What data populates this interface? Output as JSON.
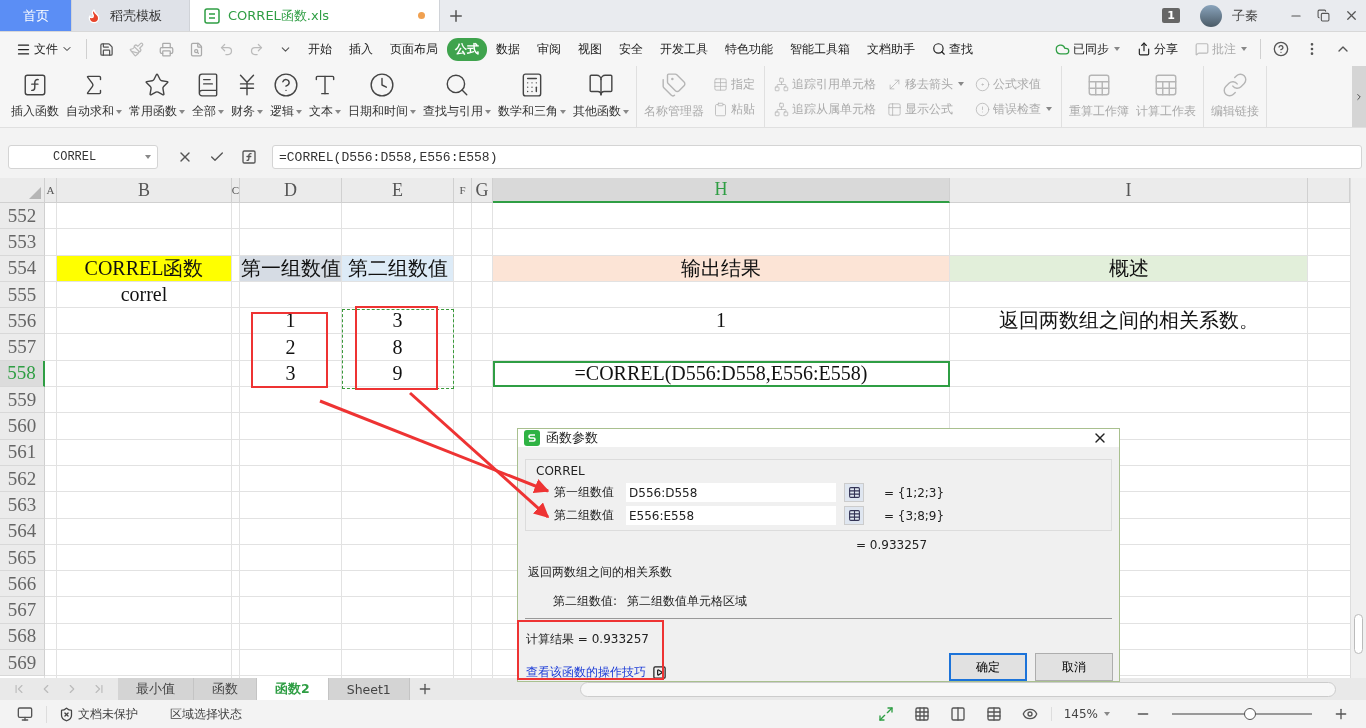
{
  "title_bar": {
    "tabs": [
      {
        "label": "首页",
        "selected": false,
        "kind": "home"
      },
      {
        "label": "稻壳模板",
        "selected": false,
        "kind": "template"
      },
      {
        "label": "CORREL函数.xls",
        "selected": true,
        "kind": "sheet",
        "unsaved": true
      }
    ],
    "notification_count": "1",
    "user_name": "子秦"
  },
  "menu_bar": {
    "file_label": "文件",
    "tabs": [
      {
        "label": "开始",
        "selected": false
      },
      {
        "label": "插入",
        "selected": false
      },
      {
        "label": "页面布局",
        "selected": false
      },
      {
        "label": "公式",
        "selected": true
      },
      {
        "label": "数据",
        "selected": false
      },
      {
        "label": "审阅",
        "selected": false
      },
      {
        "label": "视图",
        "selected": false
      },
      {
        "label": "安全",
        "selected": false
      },
      {
        "label": "开发工具",
        "selected": false
      },
      {
        "label": "特色功能",
        "selected": false
      },
      {
        "label": "智能工具箱",
        "selected": false
      },
      {
        "label": "文档助手",
        "selected": false
      }
    ],
    "search_label": "查找",
    "sync_label": "已同步",
    "share_label": "分享",
    "comment_label": "批注"
  },
  "ribbon": {
    "groups": [
      {
        "columns": [
          {
            "kind": "large",
            "label": "插入函数",
            "dropdown": false,
            "disabled": false
          },
          {
            "kind": "large",
            "label": "自动求和",
            "dropdown": true,
            "disabled": false
          },
          {
            "kind": "large",
            "label": "常用函数",
            "dropdown": true,
            "disabled": false
          },
          {
            "kind": "large",
            "label": "全部",
            "dropdown": true,
            "disabled": false
          },
          {
            "kind": "large",
            "label": "财务",
            "dropdown": true,
            "disabled": false
          },
          {
            "kind": "large",
            "label": "逻辑",
            "dropdown": true,
            "disabled": false
          },
          {
            "kind": "large",
            "label": "文本",
            "dropdown": true,
            "disabled": false
          },
          {
            "kind": "large",
            "label": "日期和时间",
            "dropdown": true,
            "disabled": false
          },
          {
            "kind": "large",
            "label": "查找与引用",
            "dropdown": true,
            "disabled": false
          },
          {
            "kind": "large",
            "label": "数学和三角",
            "dropdown": true,
            "disabled": false
          },
          {
            "kind": "large",
            "label": "其他函数",
            "dropdown": true,
            "disabled": false
          }
        ]
      },
      {
        "columns": [
          {
            "kind": "large",
            "label": "名称管理器",
            "dropdown": false,
            "disabled": true
          },
          {
            "kind": "stack",
            "items": [
              {
                "label": "指定",
                "dropdown": false,
                "disabled": true
              },
              {
                "label": "粘贴",
                "dropdown": false,
                "disabled": true
              }
            ]
          }
        ]
      },
      {
        "columns": [
          {
            "kind": "stack",
            "items": [
              {
                "label": "追踪引用单元格",
                "dropdown": false,
                "disabled": true
              },
              {
                "label": "追踪从属单元格",
                "dropdown": false,
                "disabled": true
              }
            ]
          },
          {
            "kind": "stack",
            "items": [
              {
                "label": "移去箭头",
                "dropdown": true,
                "disabled": true
              },
              {
                "label": "显示公式",
                "dropdown": false,
                "disabled": true
              }
            ]
          },
          {
            "kind": "stack",
            "items": [
              {
                "label": "公式求值",
                "dropdown": false,
                "disabled": true
              },
              {
                "label": "错误检查",
                "dropdown": true,
                "disabled": true
              }
            ]
          }
        ]
      },
      {
        "columns": [
          {
            "kind": "large",
            "label": "重算工作簿",
            "dropdown": false,
            "disabled": true
          },
          {
            "kind": "large",
            "label": "计算工作表",
            "dropdown": false,
            "disabled": true
          }
        ]
      },
      {
        "columns": [
          {
            "kind": "large",
            "label": "编辑链接",
            "dropdown": false,
            "disabled": true
          }
        ]
      }
    ]
  },
  "formula_bar": {
    "name_box": "CORREL",
    "formula": "=CORREL(D556:D558,E556:E558)"
  },
  "sheet": {
    "columns": [
      {
        "label": "A",
        "selected": false
      },
      {
        "label": "B",
        "selected": false
      },
      {
        "label": "C",
        "selected": false
      },
      {
        "label": "D",
        "selected": false
      },
      {
        "label": "E",
        "selected": false
      },
      {
        "label": "F",
        "selected": false
      },
      {
        "label": "G",
        "selected": false
      },
      {
        "label": "H",
        "selected": true
      },
      {
        "label": "I",
        "selected": false
      }
    ],
    "rows": [
      {
        "number": "552",
        "selected": false,
        "cells": {}
      },
      {
        "number": "553",
        "selected": false,
        "cells": {}
      },
      {
        "number": "554",
        "selected": false,
        "cells": {
          "B": {
            "text": "CORREL函数",
            "color": "#ffff00"
          },
          "D": {
            "text": "第一组数值",
            "color": "#d6dce4"
          },
          "E": {
            "text": "第二组数值",
            "color": "#ddebf7"
          },
          "H": {
            "text": "输出结果",
            "color": "#fce4d6"
          },
          "I": {
            "text": "概述",
            "color": "#e2efda"
          }
        }
      },
      {
        "number": "555",
        "selected": false,
        "cells": {
          "B": {
            "text": "correl"
          }
        }
      },
      {
        "number": "556",
        "selected": false,
        "cells": {
          "D": {
            "text": "1"
          },
          "E": {
            "text": "3"
          },
          "H": {
            "text": "1"
          },
          "I": {
            "text": "返回两数组之间的相关系数。"
          }
        }
      },
      {
        "number": "557",
        "selected": false,
        "cells": {
          "D": {
            "text": "2"
          },
          "E": {
            "text": "8"
          }
        }
      },
      {
        "number": "558",
        "selected": true,
        "cells": {
          "D": {
            "text": "3"
          },
          "E": {
            "text": "9"
          },
          "H": {
            "text": "=CORREL(D556:D558,E556:E558)",
            "selected": true
          }
        }
      },
      {
        "number": "559",
        "selected": false,
        "cells": {}
      },
      {
        "number": "560",
        "selected": false,
        "cells": {}
      },
      {
        "number": "561",
        "selected": false,
        "cells": {}
      },
      {
        "number": "562",
        "selected": false,
        "cells": {}
      },
      {
        "number": "563",
        "selected": false,
        "cells": {}
      },
      {
        "number": "564",
        "selected": false,
        "cells": {}
      },
      {
        "number": "565",
        "selected": false,
        "cells": {}
      },
      {
        "number": "566",
        "selected": false,
        "cells": {}
      },
      {
        "number": "567",
        "selected": false,
        "cells": {}
      },
      {
        "number": "568",
        "selected": false,
        "cells": {}
      },
      {
        "number": "569",
        "selected": false,
        "cells": {}
      }
    ]
  },
  "dialog": {
    "title": "函数参数",
    "function_name": "CORREL",
    "arguments": [
      {
        "label": "第一组数值",
        "value": "D556:D558",
        "result": "= {1;2;3}"
      },
      {
        "label": "第二组数值",
        "value": "E556:E558",
        "result": "= {3;8;9}"
      }
    ],
    "formula_result": "=  0.933257",
    "description": "返回两数组之间的相关系数",
    "hint_label": "第二组数值:",
    "hint": "第二组数值单元格区域",
    "calculation_result": "计算结果  =  0.933257",
    "help_link": "查看该函数的操作技巧",
    "buttons": [
      {
        "label": "确定",
        "kind": "primary"
      },
      {
        "label": "取消",
        "kind": "secondary"
      }
    ]
  },
  "sheet_tabs": [
    {
      "label": "最小值",
      "selected": false
    },
    {
      "label": "函数",
      "selected": false
    },
    {
      "label": "函数2",
      "selected": true
    },
    {
      "label": "Sheet1",
      "selected": false
    }
  ],
  "status_bar": {
    "protection": "文档未保护",
    "mode": "区域选择状态",
    "zoom": "145%",
    "zoom_slider": {
      "level": 0.56
    }
  }
}
